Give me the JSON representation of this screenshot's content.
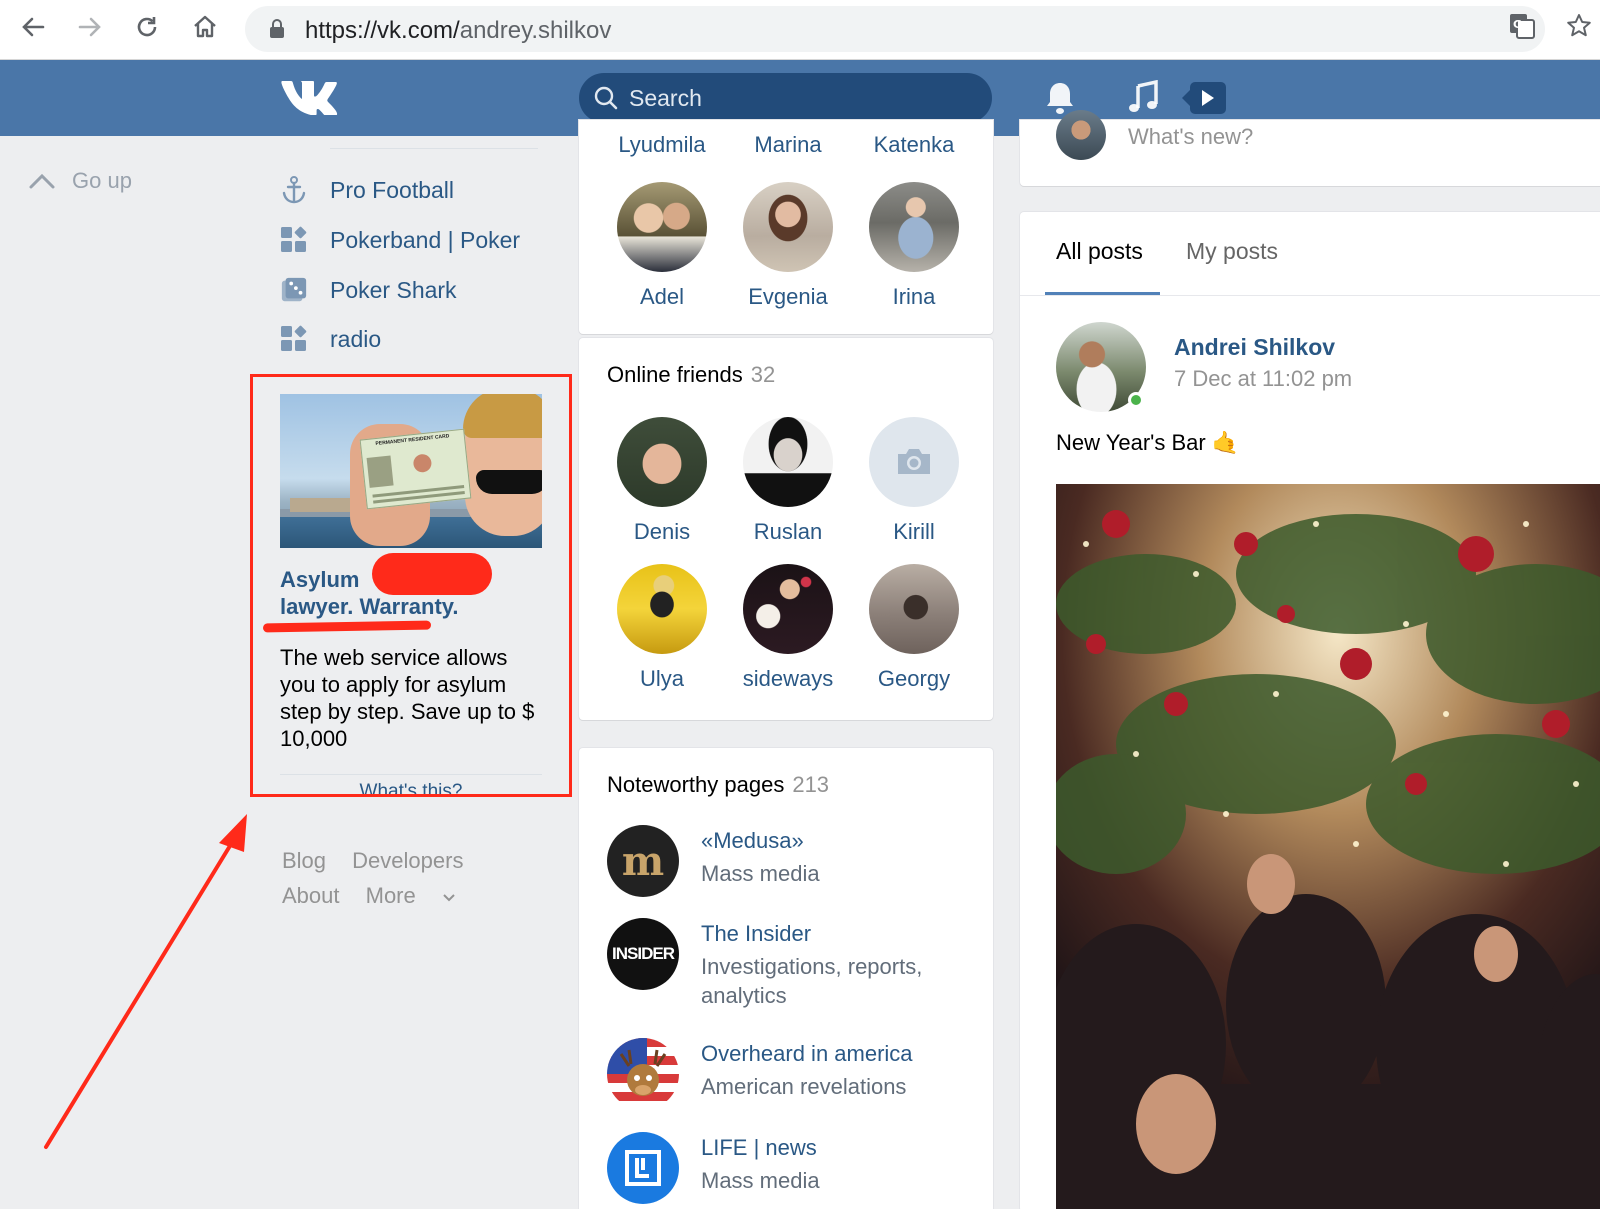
{
  "browser": {
    "url_host": "https://vk.com/",
    "url_path": "andrey.shilkov"
  },
  "header": {
    "search_placeholder": "Search"
  },
  "left": {
    "go_up": "Go up",
    "menu": [
      {
        "label": "Pro Football",
        "icon": "anchor-icon"
      },
      {
        "label": "Pokerband | Poker",
        "icon": "apps-icon"
      },
      {
        "label": "Poker Shark",
        "icon": "game-icon"
      },
      {
        "label": "radio",
        "icon": "apps-icon"
      }
    ],
    "ad": {
      "title_line1": "Asylum",
      "title_line2": "lawyer. Warranty.",
      "description": "The web service allows you to apply for asylum step by step. Save up to $ 10,000",
      "whats_this": "What's this?",
      "card_caption": "PERMANENT RESIDENT CARD"
    },
    "footer": [
      "Blog",
      "Developers",
      "About",
      "More"
    ]
  },
  "friends": {
    "top_names": [
      "Lyudmila",
      "Marina",
      "Katenka"
    ],
    "row2": [
      "Adel",
      "Evgenia",
      "Irina"
    ]
  },
  "online_friends": {
    "title": "Online friends",
    "count": "32",
    "row1": [
      "Denis",
      "Ruslan",
      "Kirill"
    ],
    "row2": [
      "Ulya",
      "sideways",
      "Georgy"
    ]
  },
  "noteworthy": {
    "title": "Noteworthy pages",
    "count": "213",
    "items": [
      {
        "name": "«Medusa»",
        "sub1": "Mass media",
        "sub2": "",
        "logo_text": "m"
      },
      {
        "name": "The Insider",
        "sub1": "Investigations, reports,",
        "sub2": "analytics",
        "logo_text": "INSIDER"
      },
      {
        "name": "Overheard in america",
        "sub1": "American revelations",
        "sub2": "",
        "logo_text": ""
      },
      {
        "name": "LIFE | news",
        "sub1": "Mass media",
        "sub2": "",
        "logo_text": ""
      }
    ]
  },
  "wall": {
    "whats_new": "What's new?",
    "tabs": [
      "All posts",
      "My posts"
    ],
    "post": {
      "author": "Andrei Shilkov",
      "date": "7 Dec at 11:02 pm",
      "text": "New Year's Bar 🤙"
    }
  }
}
